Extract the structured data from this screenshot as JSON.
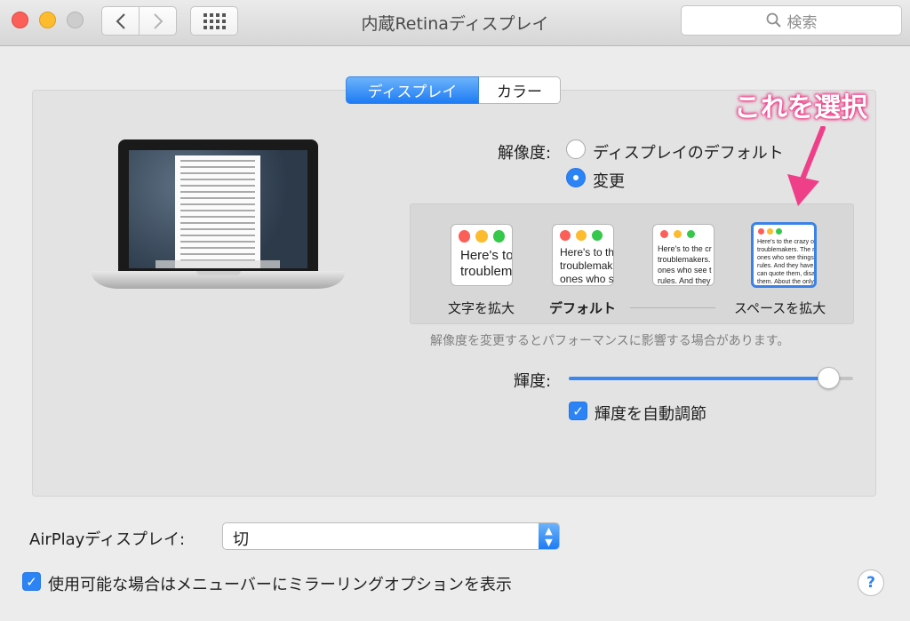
{
  "window": {
    "title": "内蔵Retinaディスプレイ",
    "search_placeholder": "検索"
  },
  "toolbar": {
    "back_icon": "chevron-left-icon",
    "forward_icon": "chevron-right-icon",
    "grid_icon": "grid-icon"
  },
  "tabs": [
    {
      "label": "ディスプレイ",
      "active": true
    },
    {
      "label": "カラー",
      "active": false
    }
  ],
  "resolution": {
    "label": "解像度:",
    "options": [
      {
        "label": "ディスプレイのデフォルト",
        "selected": false
      },
      {
        "label": "変更",
        "selected": true
      }
    ],
    "scales": [
      {
        "label": "文字を拡大",
        "sample": "Here's to\ntroublem",
        "selected": false
      },
      {
        "label": "デフォルト",
        "sample": "Here's to th\ntroublemak\nones who s",
        "selected": false
      },
      {
        "label": "",
        "sample": "Here's to the cr\ntroublemakers.\nones who see t\nrules. And they",
        "selected": false
      },
      {
        "label": "スペースを拡大",
        "sample": "Here's to the crazy one\ntroublemakers. The rou\nones who see things dif\nrules. And they have no\ncan quote them, disagr\nthem. About the only th\nBecause they change th",
        "selected": true
      }
    ],
    "note": "解像度を変更するとパフォーマンスに影響する場合があります。"
  },
  "brightness": {
    "label": "輝度:",
    "level": 0.92,
    "auto_label": "輝度を自動調節",
    "auto_checked": true
  },
  "annotation": {
    "text": "これを選択",
    "color": "#ef3f88"
  },
  "airplay": {
    "label": "AirPlayディスプレイ:",
    "value": "切",
    "mirror_label": "使用可能な場合はメニューバーにミラーリングオプションを表示",
    "mirror_checked": true
  },
  "help": {
    "label": "?"
  },
  "colors": {
    "accent": "#2b83f6",
    "background": "#ececec",
    "panel": "#e3e3e3"
  }
}
